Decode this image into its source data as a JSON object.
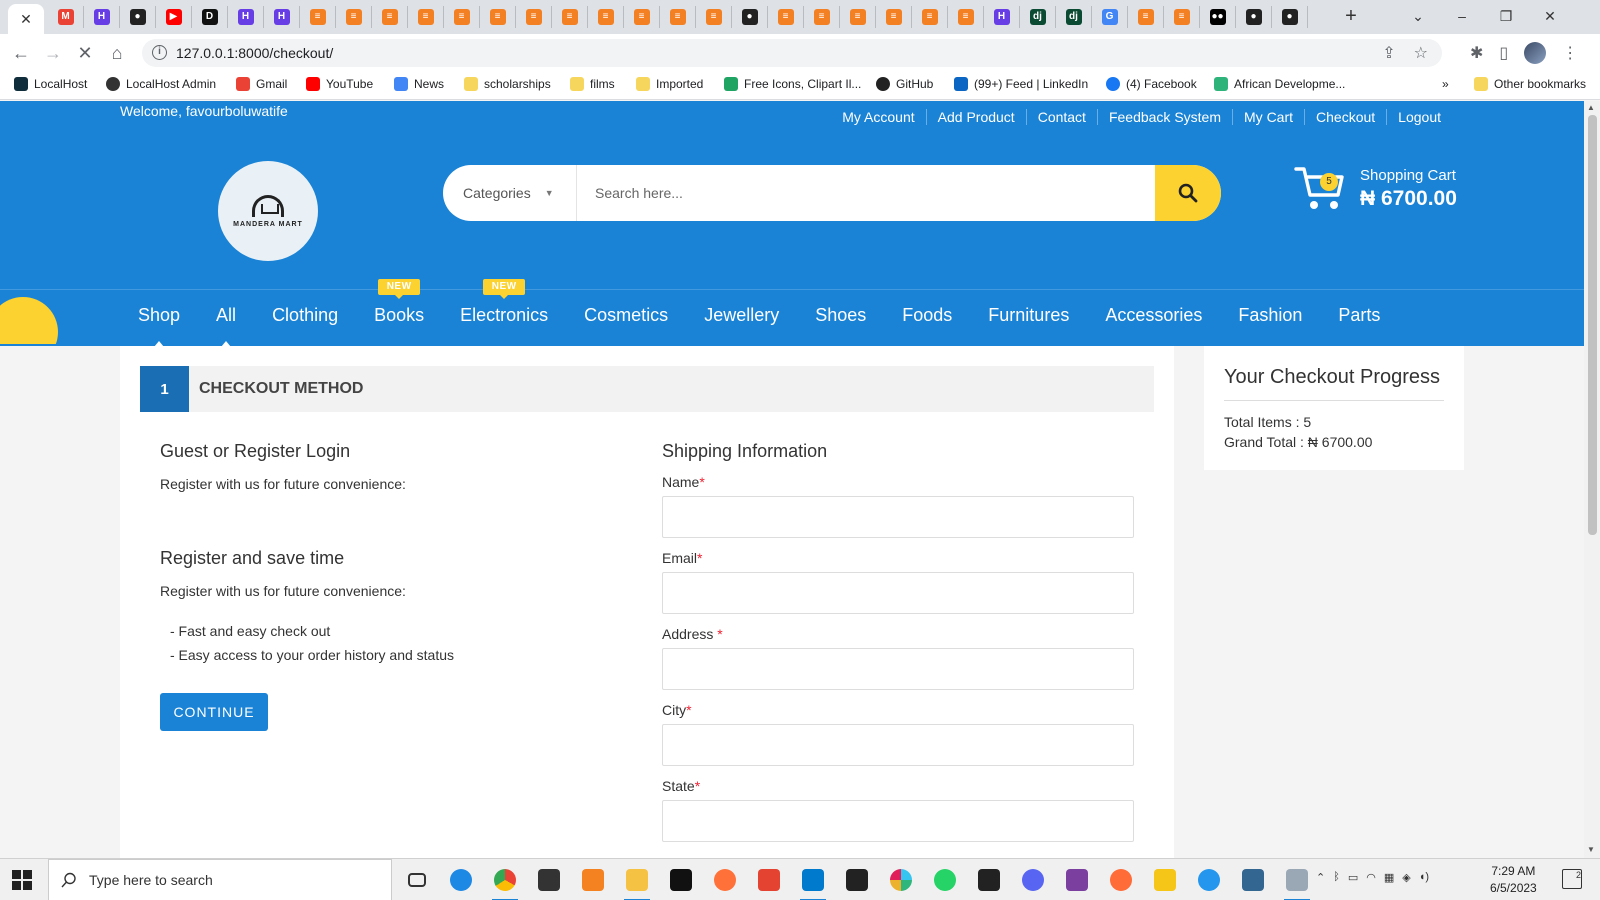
{
  "browser": {
    "url": "127.0.0.1:8000/checkout/",
    "tab_favicons": [
      "gmail",
      "hostinger",
      "github",
      "youtube",
      "dev",
      "hostinger",
      "hostinger",
      "stackoverflow",
      "stackoverflow",
      "stackoverflow",
      "stackoverflow",
      "stackoverflow",
      "stackoverflow",
      "stackoverflow",
      "stackoverflow",
      "stackoverflow",
      "stackoverflow",
      "stackoverflow",
      "stackoverflow",
      "github",
      "stackoverflow",
      "stackoverflow",
      "stackoverflow",
      "stackoverflow",
      "stackoverflow",
      "stackoverflow",
      "hostinger",
      "django",
      "django",
      "google",
      "stackoverflow",
      "stackoverflow",
      "medium",
      "github",
      "github"
    ],
    "bookmarks": [
      "LocalHost",
      "LocalHost Admin",
      "Gmail",
      "YouTube",
      "News",
      "scholarships",
      "films",
      "Imported",
      "Free Icons, Clipart Il...",
      "GitHub",
      "(99+) Feed | LinkedIn",
      "(4) Facebook",
      "African Developme..."
    ],
    "bookmarks_more": "»",
    "other_bookmarks": "Other bookmarks"
  },
  "topbar": {
    "welcome": "Welcome, favourboluwatife",
    "links": [
      "My Account",
      "Add Product",
      "Contact",
      "Feedback System",
      "My Cart",
      "Checkout",
      "Logout"
    ]
  },
  "logo": {
    "text": "MANDERA MART"
  },
  "search": {
    "category_label": "Categories",
    "placeholder": "Search here..."
  },
  "cart": {
    "count": "5",
    "label": "Shopping Cart",
    "total": "₦ 6700.00"
  },
  "nav": {
    "items": [
      "Shop",
      "All",
      "Clothing",
      "Books",
      "Electronics",
      "Cosmetics",
      "Jewellery",
      "Shoes",
      "Foods",
      "Furnitures",
      "Accessories",
      "Fashion",
      "Parts"
    ],
    "new_badge": "NEW"
  },
  "checkout": {
    "step_number": "1",
    "step_title": "CHECKOUT METHOD",
    "guest_title": "Guest or Register Login",
    "guest_text": "Register with us for future convenience:",
    "register_title": "Register and save time",
    "register_text": "Register with us for future convenience:",
    "benefits": [
      "- Fast and easy check out",
      "- Easy access to your order history and status"
    ],
    "continue_label": "CONTINUE",
    "shipping_title": "Shipping Information",
    "fields": {
      "name": "Name",
      "email": "Email",
      "address": "Address",
      "city": "City",
      "state": "State"
    },
    "required_mark": "*"
  },
  "progress": {
    "title": "Your Checkout Progress",
    "total_items": "Total Items : 5",
    "grand_total": "Grand Total : ₦ 6700.00"
  },
  "taskbar": {
    "search_placeholder": "Type here to search",
    "time": "7:29 AM",
    "date": "6/5/2023",
    "notification_count": "2"
  },
  "colors": {
    "brand_blue": "#1a83d6",
    "accent_yellow": "#fbd22f",
    "step_blue": "#1a6fb4"
  }
}
